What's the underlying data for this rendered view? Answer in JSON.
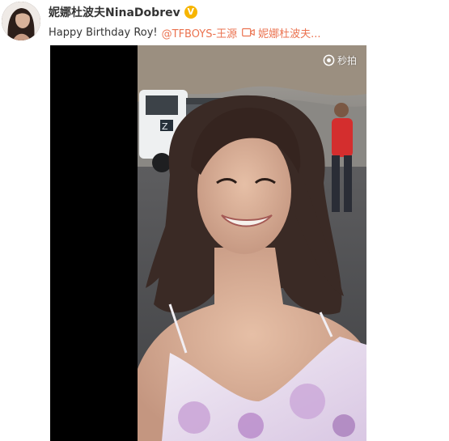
{
  "post": {
    "author": "妮娜杜波夫NinaDobrev",
    "verified_badge": "V",
    "text": "Happy Birthday Roy!",
    "mention": "@TFBOYS-王源",
    "video_link_label": "妮娜杜波夫...",
    "watermark": "秒拍"
  },
  "icons": {
    "avatar": "avatar-photo",
    "verified": "verified-badge-icon",
    "video": "video-camera-icon",
    "watermark": "miaopai-logo-icon"
  },
  "colors": {
    "link": "#eb7350",
    "badge": "#f7b500",
    "text": "#333333"
  }
}
